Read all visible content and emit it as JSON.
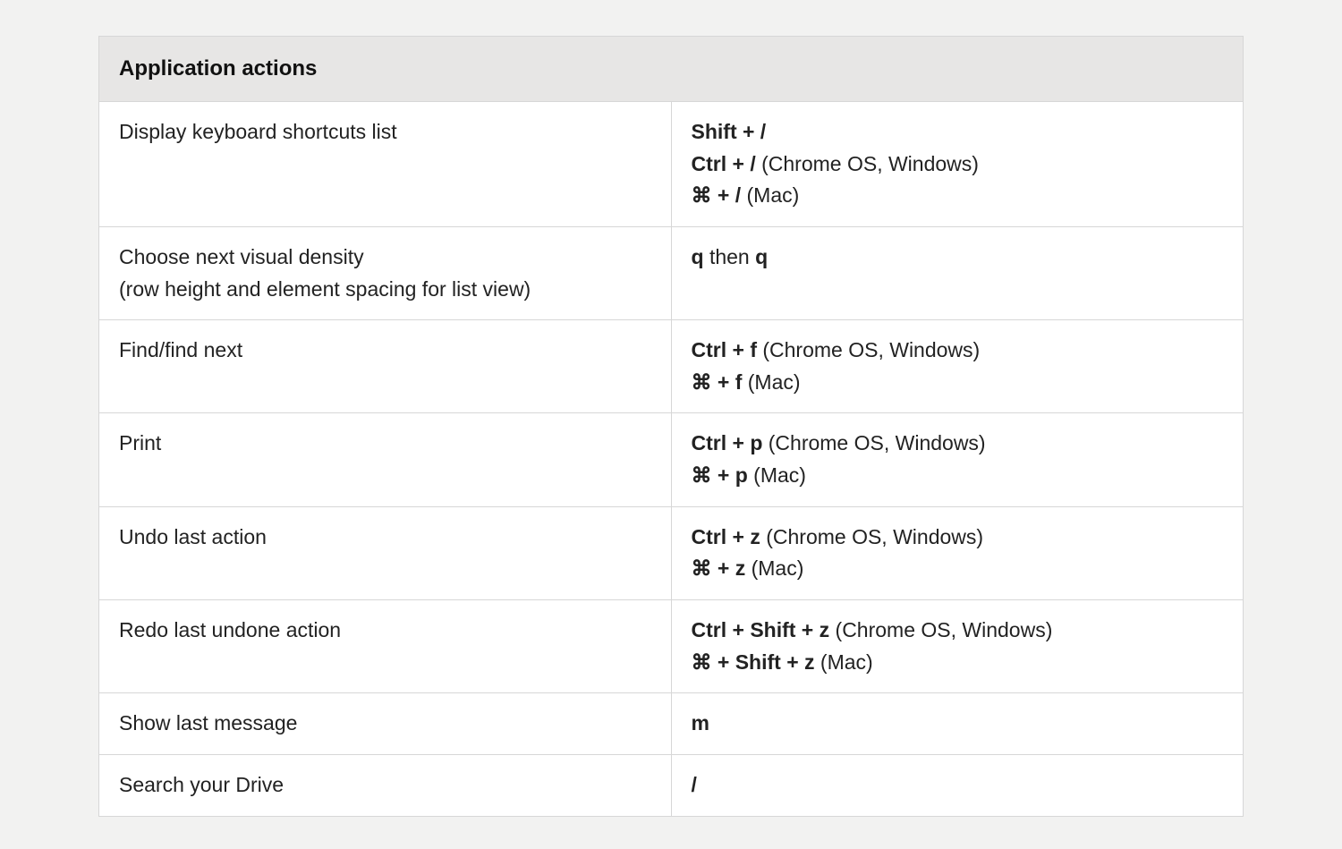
{
  "table": {
    "header": "Application actions",
    "rows": [
      {
        "action": "Display keyboard shortcuts list",
        "shortcuts": [
          [
            {
              "t": "Shift + /",
              "b": true
            }
          ],
          [
            {
              "t": "Ctrl + /",
              "b": true
            },
            {
              "t": " (Chrome OS, Windows)",
              "b": false
            }
          ],
          [
            {
              "t": "⌘ + /",
              "b": true
            },
            {
              "t": " (Mac)",
              "b": false
            }
          ]
        ]
      },
      {
        "action": "Choose next visual density\n(row height and element spacing for list view)",
        "shortcuts": [
          [
            {
              "t": "q",
              "b": true
            },
            {
              "t": " then ",
              "b": false
            },
            {
              "t": "q",
              "b": true
            }
          ]
        ]
      },
      {
        "action": "Find/find next",
        "shortcuts": [
          [
            {
              "t": "Ctrl + f",
              "b": true
            },
            {
              "t": " (Chrome OS, Windows)",
              "b": false
            }
          ],
          [
            {
              "t": "⌘ + f",
              "b": true
            },
            {
              "t": " (Mac)",
              "b": false
            }
          ]
        ]
      },
      {
        "action": "Print",
        "shortcuts": [
          [
            {
              "t": "Ctrl + p",
              "b": true
            },
            {
              "t": " (Chrome OS, Windows)",
              "b": false
            }
          ],
          [
            {
              "t": "⌘ + p",
              "b": true
            },
            {
              "t": " (Mac)",
              "b": false
            }
          ]
        ]
      },
      {
        "action": "Undo last action",
        "shortcuts": [
          [
            {
              "t": "Ctrl + z",
              "b": true
            },
            {
              "t": " (Chrome OS, Windows)",
              "b": false
            }
          ],
          [
            {
              "t": "⌘ + z",
              "b": true
            },
            {
              "t": " (Mac)",
              "b": false
            }
          ]
        ]
      },
      {
        "action": "Redo last undone action",
        "shortcuts": [
          [
            {
              "t": "Ctrl + Shift + z",
              "b": true
            },
            {
              "t": " (Chrome OS, Windows)",
              "b": false
            }
          ],
          [
            {
              "t": "⌘ + Shift + z",
              "b": true
            },
            {
              "t": " (Mac)",
              "b": false
            }
          ]
        ]
      },
      {
        "action": "Show last message",
        "shortcuts": [
          [
            {
              "t": "m",
              "b": true
            }
          ]
        ]
      },
      {
        "action": "Search your Drive",
        "shortcuts": [
          [
            {
              "t": "/",
              "b": true
            }
          ]
        ]
      }
    ]
  }
}
